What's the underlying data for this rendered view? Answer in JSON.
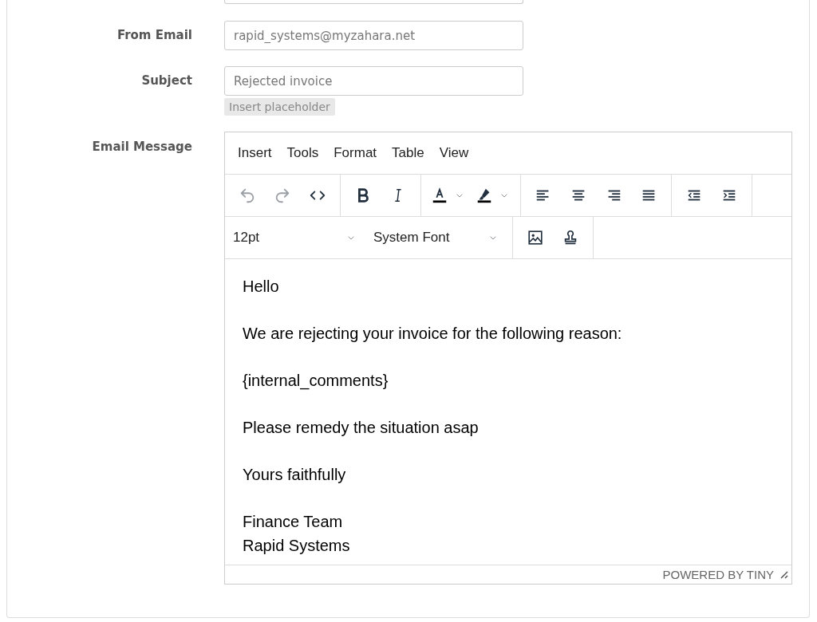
{
  "fields": [
    {
      "label": "From Email",
      "value": "rapid_systems@myzahara.net"
    },
    {
      "label": "Subject",
      "value": "Rejected invoice",
      "chip": "Insert placeholder"
    }
  ],
  "editor": {
    "label": "Email Message",
    "menu": [
      "Insert",
      "Tools",
      "Format",
      "Table",
      "View"
    ],
    "history_buttons": [
      {
        "disabled": true
      },
      {
        "disabled": true
      }
    ],
    "font_size": "12pt",
    "font_family": "System Font",
    "paragraphs": [
      [
        "Hello"
      ],
      [
        "We are rejecting your invoice for the following reason:"
      ],
      [
        "{internal_comments}"
      ],
      [
        "Please remedy the situation asap"
      ],
      [
        "Yours faithfully"
      ],
      [
        "Finance Team",
        "Rapid Systems"
      ]
    ],
    "branding": "POWERED BY TINY"
  }
}
